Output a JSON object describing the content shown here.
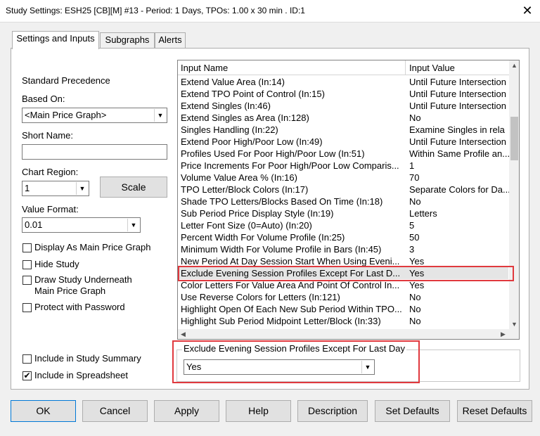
{
  "window": {
    "title": "Study Settings: ESH25 [CB][M] #13 - Period: 1 Days, TPOs: 1.00 x 30 min  . ID:1",
    "close_glyph": "✕"
  },
  "tabs": [
    {
      "label": "Settings and Inputs",
      "active": true
    },
    {
      "label": "Subgraphs",
      "active": false
    },
    {
      "label": "Alerts",
      "active": false
    }
  ],
  "left": {
    "standard_precedence": "Standard Precedence",
    "based_on_label": "Based On:",
    "based_on_value": "<Main Price Graph>",
    "short_name_label": "Short Name:",
    "short_name_value": "",
    "chart_region_label": "Chart Region:",
    "chart_region_value": "1",
    "scale_button": "Scale",
    "value_format_label": "Value Format:",
    "value_format_value": "0.01",
    "checkboxes": [
      {
        "label": "Display As Main Price Graph",
        "checked": false
      },
      {
        "label": "Hide Study",
        "checked": false
      },
      {
        "label": "Draw Study Underneath",
        "label2": "Main Price Graph",
        "checked": false
      },
      {
        "label": "Protect with Password",
        "checked": false
      },
      {
        "label": "Include in Study Summary",
        "checked": false
      },
      {
        "label": "Include in Spreadsheet",
        "checked": true
      }
    ]
  },
  "grid": {
    "col_name": "Input Name",
    "col_value": "Input Value",
    "rows": [
      {
        "name": "Extend Value Area   (In:14)",
        "value": "Until Future Intersection"
      },
      {
        "name": "Extend TPO Point of Control   (In:15)",
        "value": "Until Future Intersection"
      },
      {
        "name": "Extend Singles   (In:46)",
        "value": "Until Future Intersection"
      },
      {
        "name": "Extend Singles as Area   (In:128)",
        "value": "No"
      },
      {
        "name": "Singles Handling   (In:22)",
        "value": "Examine Singles in rela"
      },
      {
        "name": "Extend Poor High/Poor Low   (In:49)",
        "value": "Until Future Intersection"
      },
      {
        "name": "Profiles Used For Poor High/Poor Low   (In:51)",
        "value": "Within Same Profile an..."
      },
      {
        "name": "Price Increments For Poor High/Poor Low Comparis...",
        "value": "1"
      },
      {
        "name": "Volume Value Area %   (In:16)",
        "value": "70"
      },
      {
        "name": "TPO Letter/Block Colors   (In:17)",
        "value": "Separate Colors for Da..."
      },
      {
        "name": "Shade TPO Letters/Blocks Based On Time   (In:18)",
        "value": "No"
      },
      {
        "name": "Sub Period Price Display Style   (In:19)",
        "value": "Letters"
      },
      {
        "name": "Letter Font Size (0=Auto)   (In:20)",
        "value": "5"
      },
      {
        "name": "Percent Width For Volume Profile   (In:25)",
        "value": "50"
      },
      {
        "name": "Minimum Width For Volume Profile in Bars   (In:45)",
        "value": "3"
      },
      {
        "name": "New Period At Day Session Start When Using Eveni...",
        "value": "Yes"
      },
      {
        "name": "Exclude Evening Session Profiles Except For Last D...",
        "value": "Yes",
        "selected": true
      },
      {
        "name": "Color Letters For Value Area And Point Of Control In...",
        "value": "Yes"
      },
      {
        "name": "Use Reverse Colors for Letters   (In:121)",
        "value": "No"
      },
      {
        "name": "Highlight Open Of Each New Sub Period Within TPO...",
        "value": "No"
      },
      {
        "name": "Highlight Sub Period Midpoint Letter/Block   (In:33)",
        "value": "No"
      }
    ]
  },
  "editor": {
    "group_title": "Exclude Evening Session Profiles Except For Last Day",
    "value": "Yes"
  },
  "buttons": {
    "ok": "OK",
    "cancel": "Cancel",
    "apply": "Apply",
    "help": "Help",
    "description": "Description",
    "set_defaults": "Set Defaults",
    "reset_defaults": "Reset Defaults"
  },
  "colors": {
    "highlight": "#e0393e",
    "selected_row": "#e5e5e5"
  }
}
